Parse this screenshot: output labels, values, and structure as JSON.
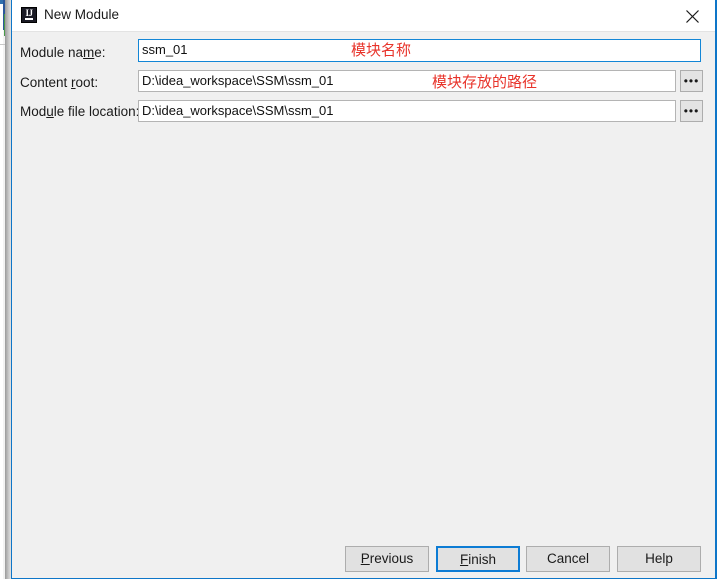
{
  "background_window": {
    "name": "partially-hidden-window-edge"
  },
  "dialog": {
    "title": "New Module",
    "icon": "intellij-idea-icon",
    "close_label": "×",
    "accent_color": "#0e76c8",
    "body_color": "#f0f0f0",
    "titlebar_color": "#ffffff"
  },
  "form": {
    "fields": [
      {
        "label_pre": "Module na",
        "label_mnemonic": "m",
        "label_post": "e:",
        "value": "ssm_01",
        "focused": true,
        "has_browse": false
      },
      {
        "label_pre": "Content ",
        "label_mnemonic": "r",
        "label_post": "oot:",
        "value": "D:\\idea_workspace\\SSM\\ssm_01",
        "focused": false,
        "has_browse": true
      },
      {
        "label_pre": "Mod",
        "label_mnemonic": "u",
        "label_post": "le file location:",
        "value": "D:\\idea_workspace\\SSM\\ssm_01",
        "focused": false,
        "has_browse": true
      }
    ],
    "browse_label": "•••"
  },
  "annotations": [
    {
      "text": "模块名称",
      "color": "#e8332a"
    },
    {
      "text": "模块存放的路径",
      "color": "#e8332a"
    }
  ],
  "buttons": [
    {
      "pre": "",
      "mnemonic": "P",
      "post": "revious",
      "default": false
    },
    {
      "pre": "",
      "mnemonic": "F",
      "post": "inish",
      "default": true
    },
    {
      "pre": "Cancel",
      "mnemonic": "",
      "post": "",
      "default": false
    },
    {
      "pre": "Help",
      "mnemonic": "",
      "post": "",
      "default": false
    }
  ]
}
